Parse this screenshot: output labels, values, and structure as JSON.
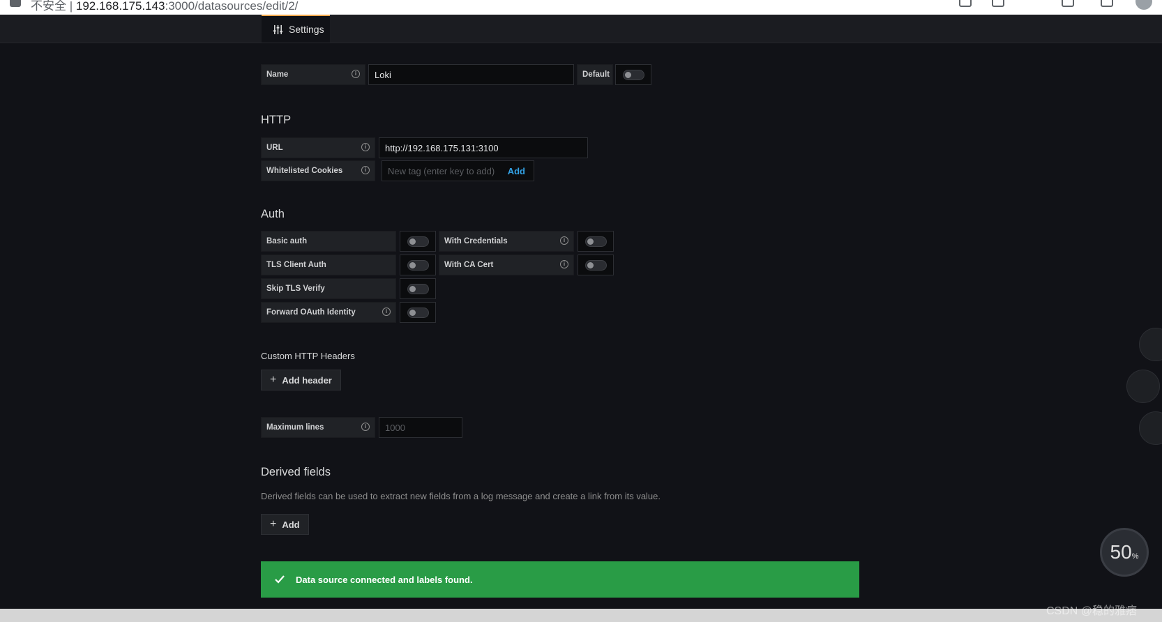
{
  "browser": {
    "security": "不安全",
    "host": "192.168.175.143",
    "path": ":3000/datasources/edit/2/"
  },
  "tab": {
    "settings_label": "Settings"
  },
  "name_row": {
    "label": "Name",
    "value": "Loki",
    "default_label": "Default"
  },
  "http": {
    "title": "HTTP",
    "url_label": "URL",
    "url_value": "http://192.168.175.131:3100",
    "cookies_label": "Whitelisted Cookies",
    "cookies_placeholder": "New tag (enter key to add)",
    "cookies_add": "Add"
  },
  "auth": {
    "title": "Auth",
    "basic_auth": "Basic auth",
    "with_credentials": "With Credentials",
    "tls_client_auth": "TLS Client Auth",
    "with_ca_cert": "With CA Cert",
    "skip_tls_verify": "Skip TLS Verify",
    "forward_oauth": "Forward OAuth Identity"
  },
  "custom_headers": {
    "title": "Custom HTTP Headers",
    "add_label": "Add header"
  },
  "max_lines": {
    "label": "Maximum lines",
    "placeholder": "1000"
  },
  "derived": {
    "title": "Derived fields",
    "description": "Derived fields can be used to extract new fields from a log message and create a link from its value.",
    "add_label": "Add"
  },
  "alert": {
    "message": "Data source connected and labels found."
  },
  "overlay": {
    "gauge_value": "50",
    "gauge_unit": "%",
    "watermark": "CSDN @稳的雅痞"
  },
  "colors": {
    "accent": "#f2a64a",
    "success": "#299c46",
    "link": "#33a2e5",
    "background": "#111217"
  }
}
